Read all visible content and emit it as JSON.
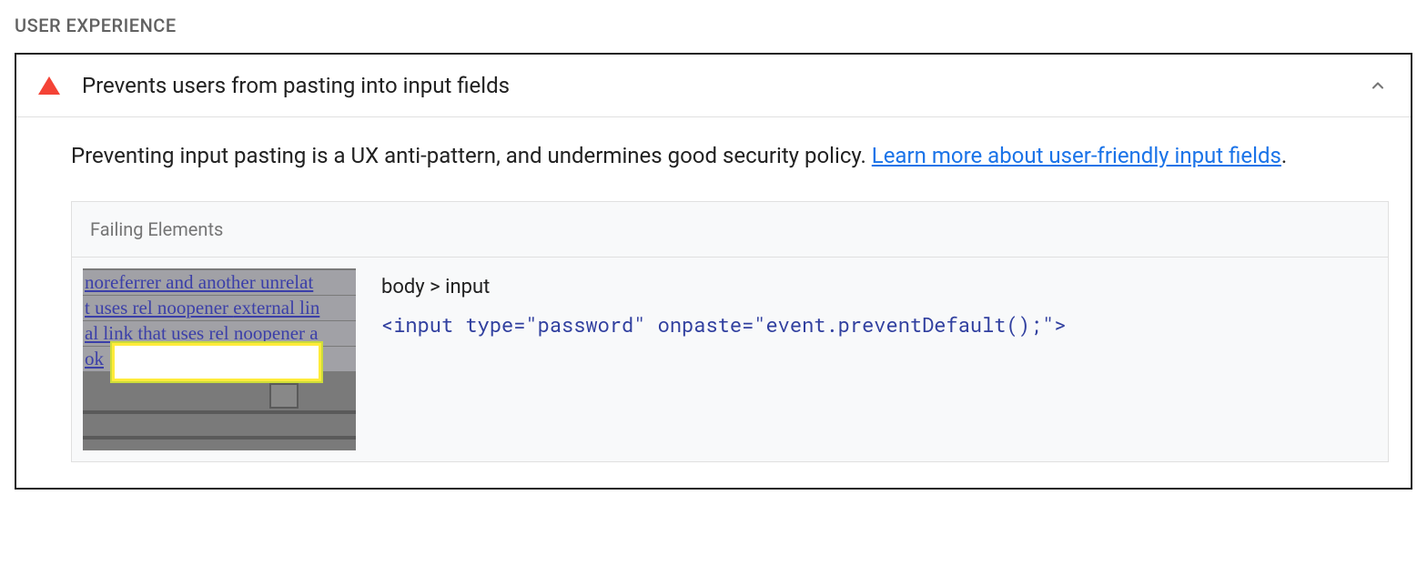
{
  "section": {
    "title": "USER EXPERIENCE"
  },
  "audit": {
    "title": "Prevents users from pasting into input fields",
    "description_text": "Preventing input pasting is a UX anti-pattern, and undermines good security policy. ",
    "description_link_text": "Learn more about user-friendly input fields",
    "description_suffix": "."
  },
  "failing": {
    "label": "Failing Elements",
    "row": {
      "selector": "body > input",
      "code": "<input type=\"password\" onpaste=\"event.preventDefault();\">"
    }
  },
  "thumbnail": {
    "l1": " noreferrer and another unrelat",
    "l2_a": "t uses rel noopener ",
    "l2_b": "external lin",
    "l3": "al link that uses rel noopener a",
    "l4": " ok"
  }
}
